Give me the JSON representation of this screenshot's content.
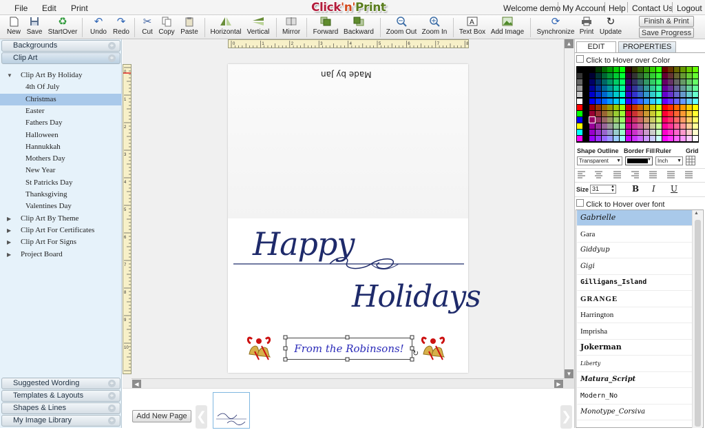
{
  "menu": {
    "file": "File",
    "edit": "Edit",
    "print": "Print"
  },
  "logo": {
    "part1": "Click",
    "part2": "'n'",
    "part3": "Print"
  },
  "account": {
    "welcome": "Welcome demo",
    "my_account": "My Account",
    "help": "Help",
    "contact": "Contact Us",
    "logout": "Logout"
  },
  "toolbar": {
    "new": "New",
    "save": "Save",
    "startover": "StartOver",
    "undo": "Undo",
    "redo": "Redo",
    "cut": "Cut",
    "copy": "Copy",
    "paste": "Paste",
    "horizontal": "Horizontal",
    "vertical": "Vertical",
    "mirror": "Mirror",
    "forward": "Forward",
    "backward": "Backward",
    "zoom_out": "Zoom Out",
    "zoom_in": "Zoom In",
    "text_box": "Text Box",
    "add_image": "Add Image",
    "synchronize": "Synchronize",
    "print": "Print",
    "update": "Update",
    "finish_print": "Finish & Print",
    "save_progress": "Save Progress"
  },
  "left_panel": {
    "backgrounds": "Backgrounds",
    "clip_art": "Clip Art",
    "tree": [
      {
        "label": "Clip Art By Holiday",
        "level": 0,
        "expanded": true
      },
      {
        "label": "4th Of July",
        "level": 1
      },
      {
        "label": "Christmas",
        "level": 1,
        "selected": true
      },
      {
        "label": "Easter",
        "level": 1
      },
      {
        "label": "Fathers Day",
        "level": 1
      },
      {
        "label": "Halloween",
        "level": 1
      },
      {
        "label": "Hannukkah",
        "level": 1
      },
      {
        "label": "Mothers Day",
        "level": 1
      },
      {
        "label": "New Year",
        "level": 1
      },
      {
        "label": "St Patricks Day",
        "level": 1
      },
      {
        "label": "Thanksgiving",
        "level": 1
      },
      {
        "label": "Valentines Day",
        "level": 1
      },
      {
        "label": "Clip Art By Theme",
        "level": 0,
        "expanded": false
      },
      {
        "label": "Clip Art For Certificates",
        "level": 0,
        "expanded": false
      },
      {
        "label": "Clip Art For Signs",
        "level": 0,
        "expanded": false
      },
      {
        "label": "Project Board",
        "level": 0,
        "expanded": false
      }
    ],
    "suggested_wording": "Suggested Wording",
    "templates_layouts": "Templates & Layouts",
    "shapes_lines": "Shapes & Lines",
    "my_image_library": "My Image Library"
  },
  "canvas": {
    "made_by": "Made by Jan",
    "happy": "Happy",
    "holidays": "Holidays",
    "text_box": "From the Robinsons!",
    "ruler_h": [
      "0",
      "1",
      "2",
      "3",
      "4",
      "5",
      "6",
      "7",
      "8"
    ],
    "ruler_v": [
      "0",
      "1",
      "2",
      "3",
      "4",
      "5",
      "6",
      "7",
      "8",
      "9",
      "10"
    ]
  },
  "page_strip": {
    "add_new_page": "Add New Page"
  },
  "right_panel": {
    "tab_edit": "EDIT",
    "tab_properties": "PROPERTIES",
    "hover_color": "Click to Hover over Color",
    "shape_outline": "Shape Outline",
    "border_fill": "Border Fill",
    "ruler": "Ruler",
    "grid": "Grid",
    "outline_value": "Transparent",
    "ruler_value": "Inch",
    "size_label": "Size",
    "size_value": "31",
    "bold": "B",
    "italic": "I",
    "underline": "U",
    "hover_font": "Click to Hover over font",
    "fonts": [
      "Gabrielle",
      "Gara",
      "Giddyup",
      "Gigi",
      "Gilligans_Island",
      "GRANGE",
      "Harrington",
      "Imprisha",
      "Jokerman",
      "Liberty",
      "Matura_Script",
      "Modern_No",
      "Monotype_Corsiva"
    ]
  },
  "colors": {
    "accent": "#3b6ca5",
    "selection": "#a9c9ea",
    "panel_bg": "#e6f2fa",
    "script": "#1e2a6a"
  }
}
